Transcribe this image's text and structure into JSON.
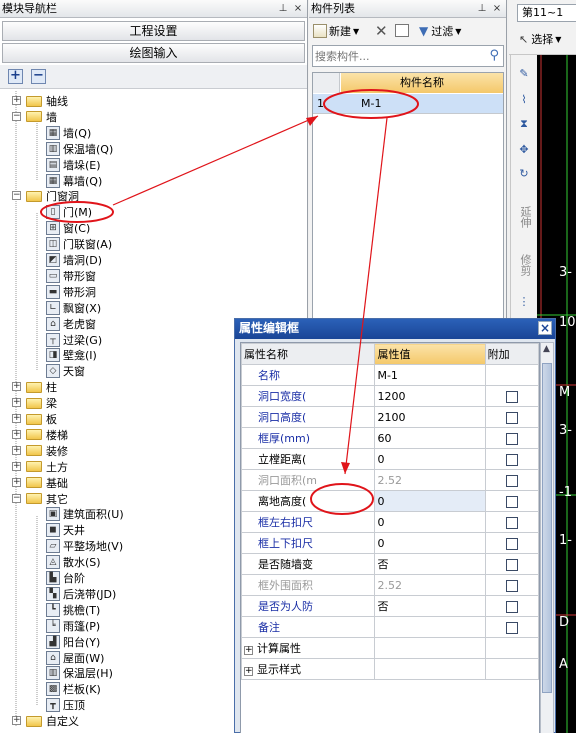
{
  "nav": {
    "title": "模块导航栏",
    "pin": "ꟷ",
    "close": "×",
    "btn_project": "工程设置",
    "btn_draw": "绘图输入",
    "add": "+",
    "minus": "−",
    "items": [
      {
        "label": "轴线",
        "type": "folder",
        "expand": "+"
      },
      {
        "label": "墙",
        "type": "folder",
        "expand": "−"
      },
      {
        "label": "墙(Q)",
        "type": "item"
      },
      {
        "label": "保温墙(Q)",
        "type": "item"
      },
      {
        "label": "墙垛(E)",
        "type": "item"
      },
      {
        "label": "幕墙(Q)",
        "type": "item"
      },
      {
        "label": "门窗洞",
        "type": "folder",
        "expand": "−"
      },
      {
        "label": "门(M)",
        "type": "item"
      },
      {
        "label": "窗(C)",
        "type": "item"
      },
      {
        "label": "门联窗(A)",
        "type": "item"
      },
      {
        "label": "墙洞(D)",
        "type": "item"
      },
      {
        "label": "带形窗",
        "type": "item"
      },
      {
        "label": "带形洞",
        "type": "item"
      },
      {
        "label": "飘窗(X)",
        "type": "item"
      },
      {
        "label": "老虎窗",
        "type": "item"
      },
      {
        "label": "过梁(G)",
        "type": "item"
      },
      {
        "label": "壁龛(I)",
        "type": "item"
      },
      {
        "label": "天窗",
        "type": "item"
      },
      {
        "label": "柱",
        "type": "folder",
        "expand": "+"
      },
      {
        "label": "梁",
        "type": "folder",
        "expand": "+"
      },
      {
        "label": "板",
        "type": "folder",
        "expand": "+"
      },
      {
        "label": "楼梯",
        "type": "folder",
        "expand": "+"
      },
      {
        "label": "装修",
        "type": "folder",
        "expand": "+"
      },
      {
        "label": "土方",
        "type": "folder",
        "expand": "+"
      },
      {
        "label": "基础",
        "type": "folder",
        "expand": "+"
      },
      {
        "label": "其它",
        "type": "folder",
        "expand": "−"
      },
      {
        "label": "建筑面积(U)",
        "type": "item"
      },
      {
        "label": "天井",
        "type": "item"
      },
      {
        "label": "平整场地(V)",
        "type": "item"
      },
      {
        "label": "散水(S)",
        "type": "item"
      },
      {
        "label": "台阶",
        "type": "item"
      },
      {
        "label": "后浇带(JD)",
        "type": "item"
      },
      {
        "label": "挑檐(T)",
        "type": "item"
      },
      {
        "label": "雨篷(P)",
        "type": "item"
      },
      {
        "label": "阳台(Y)",
        "type": "item"
      },
      {
        "label": "屋面(W)",
        "type": "item"
      },
      {
        "label": "保温层(H)",
        "type": "item"
      },
      {
        "label": "栏板(K)",
        "type": "item"
      },
      {
        "label": "压顶",
        "type": "item"
      },
      {
        "label": "自定义",
        "type": "folder",
        "expand": "+"
      }
    ]
  },
  "comp": {
    "title": "构件列表",
    "new": "新建",
    "filter": "过滤",
    "search_placeholder": "搜索构件...",
    "col_name": "构件名称",
    "row_num": "1",
    "row_name": "M-1"
  },
  "toolbar": {
    "floor": "第11~1",
    "select": "选择",
    "v_extend": "延伸",
    "v_modify": "修剪"
  },
  "prop": {
    "title": "属性编辑框",
    "close": "×",
    "col_name": "属性名称",
    "col_value": "属性值",
    "col_extra": "附加",
    "rows": [
      {
        "name": "名称",
        "value": "M-1",
        "style": "blue",
        "chk": false
      },
      {
        "name": "洞口宽度(",
        "value": "1200",
        "style": "blue",
        "chk": true
      },
      {
        "name": "洞口高度(",
        "value": "2100",
        "style": "blue",
        "chk": true
      },
      {
        "name": "框厚(mm)",
        "value": "60",
        "style": "blue",
        "chk": true
      },
      {
        "name": "立樘距离(",
        "value": "0",
        "style": "black",
        "chk": true
      },
      {
        "name": "洞口面积(m",
        "value": "2.52",
        "style": "gray",
        "chk": true
      },
      {
        "name": "离地高度(",
        "value": "0",
        "style": "black",
        "chk": true
      },
      {
        "name": "框左右扣尺",
        "value": "0",
        "style": "blue",
        "chk": true
      },
      {
        "name": "框上下扣尺",
        "value": "0",
        "style": "blue",
        "chk": true
      },
      {
        "name": "是否随墙变",
        "value": "否",
        "style": "black",
        "chk": true
      },
      {
        "name": "框外围面积",
        "value": "2.52",
        "style": "gray",
        "chk": true
      },
      {
        "name": "是否为人防",
        "value": "否",
        "style": "blue",
        "chk": true
      },
      {
        "name": "备注",
        "value": "",
        "style": "blue",
        "chk": true
      },
      {
        "name": "计算属性",
        "value": "",
        "style": "group",
        "chk": false
      },
      {
        "name": "显示样式",
        "value": "",
        "style": "group",
        "chk": false
      }
    ]
  },
  "cad_labels": [
    "3-",
    "10",
    "M",
    "3-",
    "-1",
    "1-",
    "D",
    "A"
  ]
}
